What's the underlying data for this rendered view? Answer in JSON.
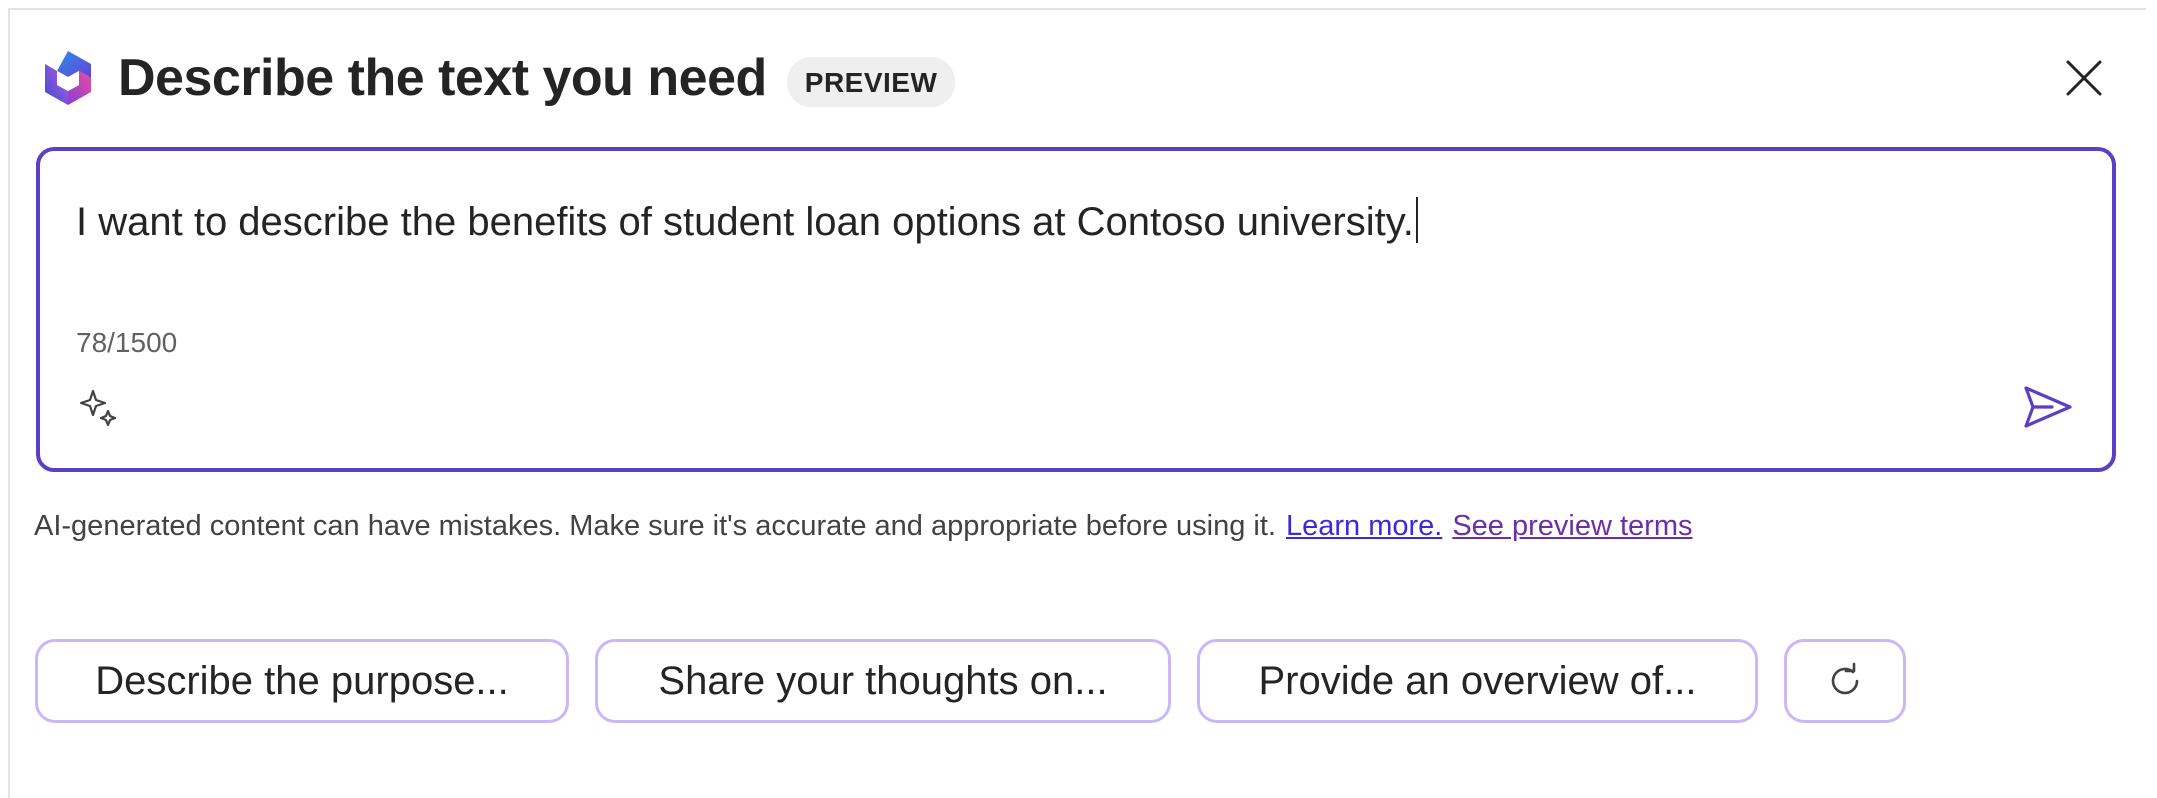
{
  "header": {
    "title": "Describe the text you need",
    "badge": "PREVIEW",
    "logo_icon": "copilot-logo-icon",
    "close_icon": "close-icon"
  },
  "prompt": {
    "value": "I want to describe the benefits of student loan options at Contoso university.",
    "char_count": "78/1500",
    "sparkle_icon": "sparkle-icon",
    "send_icon": "send-icon"
  },
  "disclaimer": {
    "text": "AI-generated content can have mistakes. Make sure it's accurate and appropriate before using it.",
    "learn_more": "Learn more.",
    "preview_terms": "See preview terms"
  },
  "suggestions": {
    "items": [
      "Describe the purpose...",
      "Share your thoughts on...",
      "Provide an overview of..."
    ],
    "refresh_icon": "refresh-icon"
  },
  "colors": {
    "accent": "#5b3fc4",
    "chip_border": "#c9b8f5",
    "link": "#3b2ad9",
    "link_visited": "#6b2fa8"
  }
}
